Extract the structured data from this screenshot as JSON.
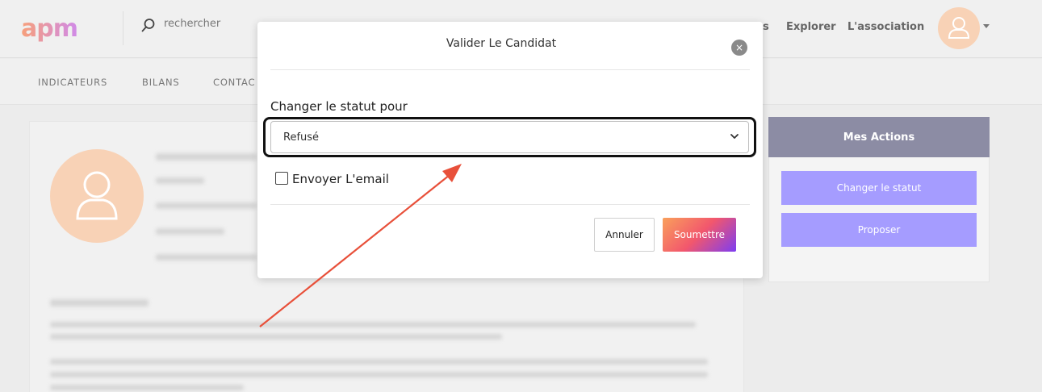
{
  "header": {
    "logo_text": "apm",
    "search_placeholder": "rechercher",
    "nav": [
      "s",
      "Explorer",
      "L'association"
    ]
  },
  "subnav": [
    "INDICATEURS",
    "BILANS",
    "CONTAC"
  ],
  "actions": {
    "title": "Mes Actions",
    "buttons": [
      "Changer le statut",
      "Proposer"
    ]
  },
  "modal": {
    "title": "Valider Le Candidat",
    "close_symbol": "×",
    "status_label": "Changer le statut pour",
    "status_value": "Refusé",
    "email_checkbox_label": "Envoyer L'email",
    "email_checked": false,
    "cancel_label": "Annuler",
    "submit_label": "Soumettre"
  },
  "colors": {
    "arrow": "#e8503a",
    "action_button": "#a59cff",
    "actions_header": "#8c8ca4",
    "avatar": "#f8d2b6"
  }
}
